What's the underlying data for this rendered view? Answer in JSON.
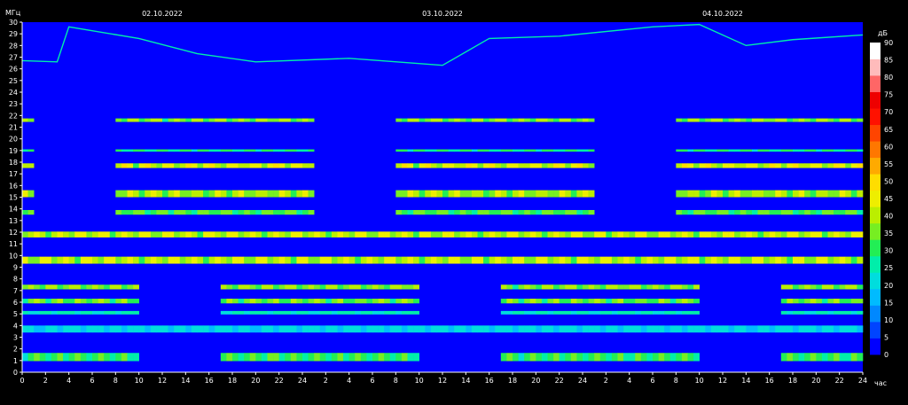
{
  "chart_data": {
    "type": "heatmap",
    "title": "",
    "ylabel": "МГц",
    "xlabel": "час",
    "colorbar_label": "дБ",
    "ylim": [
      0,
      30
    ],
    "y_ticks": [
      "0",
      "1",
      "2",
      "3",
      "4",
      "5",
      "6",
      "7",
      "8",
      "9",
      "10",
      "11",
      "12",
      "13",
      "14",
      "15",
      "16",
      "17",
      "18",
      "19",
      "20",
      "21",
      "22",
      "23",
      "24",
      "25",
      "26",
      "27",
      "28",
      "29",
      "30"
    ],
    "x_ticks": [
      "0",
      "2",
      "4",
      "6",
      "8",
      "10",
      "12",
      "14",
      "16",
      "18",
      "20",
      "22",
      "24",
      "2",
      "4",
      "6",
      "8",
      "10",
      "12",
      "14",
      "16",
      "18",
      "20",
      "22",
      "24",
      "2",
      "4",
      "6",
      "8",
      "10",
      "12",
      "14",
      "16",
      "18",
      "20",
      "22",
      "24"
    ],
    "x_hours_range": [
      0,
      72
    ],
    "dates": [
      {
        "label": "02.10.2022",
        "hour": 12
      },
      {
        "label": "03.10.2022",
        "hour": 36
      },
      {
        "label": "04.10.2022",
        "hour": 60
      }
    ],
    "colorbar": {
      "range": [
        0,
        90
      ],
      "ticks": [
        "0",
        "5",
        "10",
        "15",
        "20",
        "25",
        "30",
        "35",
        "40",
        "45",
        "50",
        "55",
        "60",
        "65",
        "70",
        "75",
        "80",
        "85",
        "90"
      ],
      "colors": [
        "#0000ff",
        "#0044ff",
        "#0088ff",
        "#00bbff",
        "#00dddd",
        "#00eeaa",
        "#22ee55",
        "#77ee22",
        "#bbee00",
        "#eeee00",
        "#ffdd00",
        "#ffaa00",
        "#ff7700",
        "#ff4400",
        "#ff1100",
        "#ee0000",
        "#ff6666",
        "#ffbbbb",
        "#ffffff"
      ]
    },
    "background_level_db": 2,
    "bands": [
      {
        "mhz": 1.3,
        "width": 0.7,
        "level_db": 28,
        "day_only": false,
        "night_only": true
      },
      {
        "mhz": 3.7,
        "width": 0.6,
        "level_db": 18,
        "day_only": false,
        "night_only": false
      },
      {
        "mhz": 5.1,
        "width": 0.3,
        "level_db": 22,
        "day_only": false,
        "night_only": true
      },
      {
        "mhz": 6.1,
        "width": 0.4,
        "level_db": 32,
        "day_only": false,
        "night_only": true
      },
      {
        "mhz": 7.3,
        "width": 0.4,
        "level_db": 34,
        "day_only": false,
        "night_only": true
      },
      {
        "mhz": 9.6,
        "width": 0.6,
        "level_db": 38,
        "day_only": false,
        "night_only": false
      },
      {
        "mhz": 11.8,
        "width": 0.5,
        "level_db": 38,
        "day_only": false,
        "night_only": false
      },
      {
        "mhz": 13.7,
        "width": 0.4,
        "level_db": 30,
        "day_only": true,
        "night_only": false
      },
      {
        "mhz": 15.3,
        "width": 0.6,
        "level_db": 36,
        "day_only": true,
        "night_only": false
      },
      {
        "mhz": 17.7,
        "width": 0.4,
        "level_db": 40,
        "day_only": true,
        "night_only": false
      },
      {
        "mhz": 19.0,
        "width": 0.2,
        "level_db": 26,
        "day_only": true,
        "night_only": false
      },
      {
        "mhz": 21.6,
        "width": 0.3,
        "level_db": 34,
        "day_only": true,
        "night_only": false
      }
    ],
    "day_window_hours": [
      8,
      25
    ],
    "night_window_hours": [
      17,
      34
    ],
    "interference_trace": [
      {
        "hour": 0,
        "mhz": 26.7
      },
      {
        "hour": 3,
        "mhz": 26.6
      },
      {
        "hour": 4,
        "mhz": 29.6
      },
      {
        "hour": 10,
        "mhz": 28.6
      },
      {
        "hour": 15,
        "mhz": 27.3
      },
      {
        "hour": 20,
        "mhz": 26.6
      },
      {
        "hour": 28,
        "mhz": 26.9
      },
      {
        "hour": 36,
        "mhz": 26.3
      },
      {
        "hour": 40,
        "mhz": 28.6
      },
      {
        "hour": 46,
        "mhz": 28.8
      },
      {
        "hour": 54,
        "mhz": 29.6
      },
      {
        "hour": 58,
        "mhz": 29.8
      },
      {
        "hour": 62,
        "mhz": 28.0
      },
      {
        "hour": 66,
        "mhz": 28.5
      },
      {
        "hour": 72,
        "mhz": 28.9
      }
    ]
  }
}
